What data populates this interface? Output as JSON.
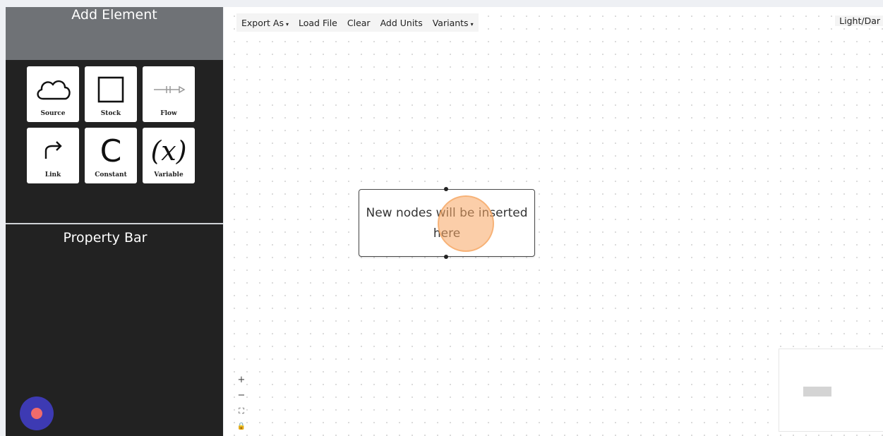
{
  "sidebar": {
    "add_title": "Add Element",
    "palette": [
      {
        "label": "Source",
        "icon": "cloud-icon"
      },
      {
        "label": "Stock",
        "icon": "square-icon"
      },
      {
        "label": "Flow",
        "icon": "flow-arrow-icon"
      },
      {
        "label": "Link",
        "icon": "curved-arrow-icon"
      },
      {
        "label": "Constant",
        "icon": "constant-c-icon"
      },
      {
        "label": "Variable",
        "icon": "variable-x-icon"
      }
    ],
    "constant_glyph": "C",
    "variable_glyph": "(x)",
    "property_title": "Property Bar"
  },
  "toolbar": {
    "export": "Export As",
    "load": "Load File",
    "clear": "Clear",
    "units": "Add Units",
    "variants": "Variants",
    "theme": "Light/Dar",
    "caret": "▾"
  },
  "canvas": {
    "node_text": "New nodes will be inserted here"
  },
  "zoom": {
    "plus": "+",
    "minus": "−",
    "fit": "⛶",
    "lock": "🔒"
  },
  "colors": {
    "sidebar_bg": "#222222",
    "header_bg": "#6f7276",
    "record_button": "#3d3ab3",
    "record_dot": "#f06b6b",
    "cursor_highlight": "#f7a662"
  }
}
